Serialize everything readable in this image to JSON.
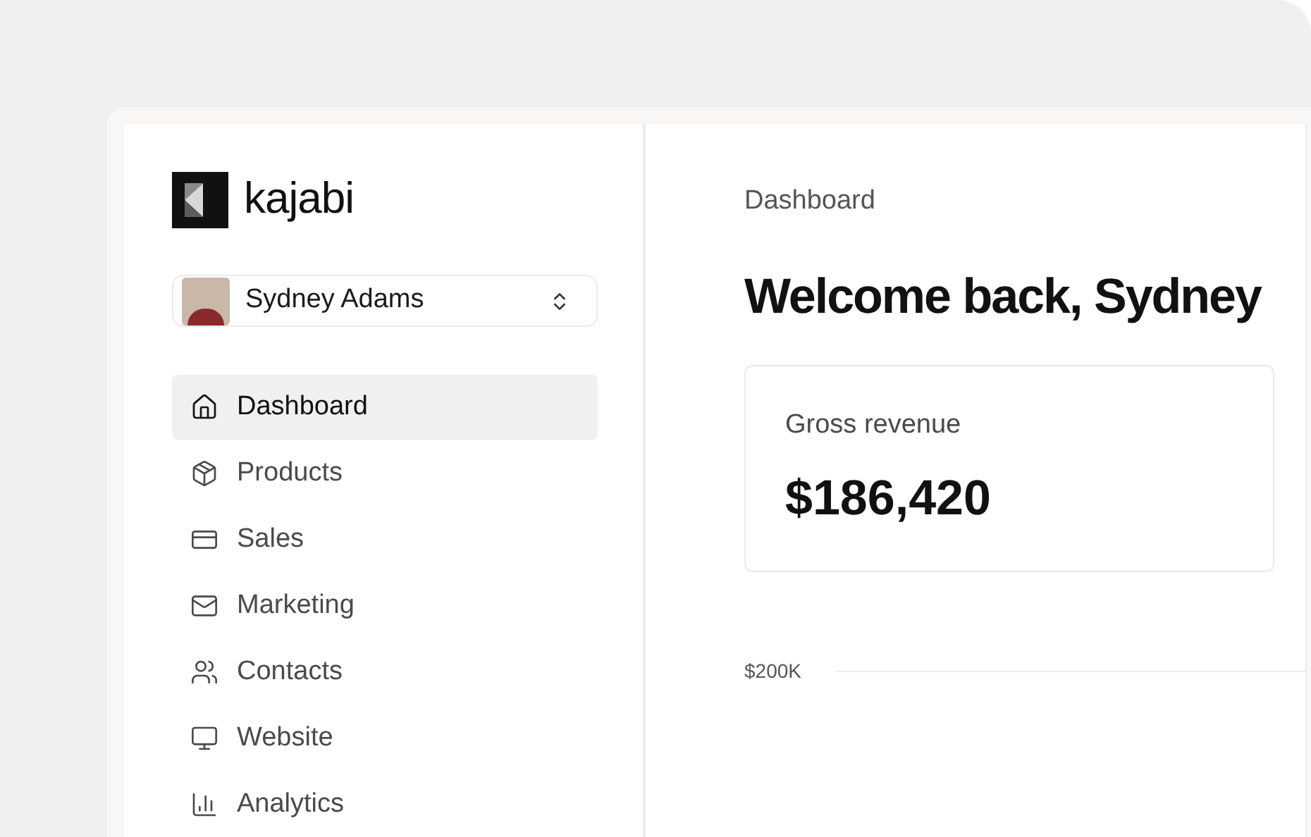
{
  "brand": {
    "name": "kajabi"
  },
  "account": {
    "name": "Sydney Adams"
  },
  "nav": [
    {
      "label": "Dashboard",
      "selected": true
    },
    {
      "label": "Products",
      "selected": false
    },
    {
      "label": "Sales",
      "selected": false
    },
    {
      "label": "Marketing",
      "selected": false
    },
    {
      "label": "Contacts",
      "selected": false
    },
    {
      "label": "Website",
      "selected": false
    },
    {
      "label": "Analytics",
      "selected": false
    }
  ],
  "breadcrumb": "Dashboard",
  "heading": "Welcome back, Sydney",
  "revenue_card": {
    "label": "Gross revenue",
    "value": "$186,420"
  },
  "chart": {
    "y_tick": "$200K"
  }
}
